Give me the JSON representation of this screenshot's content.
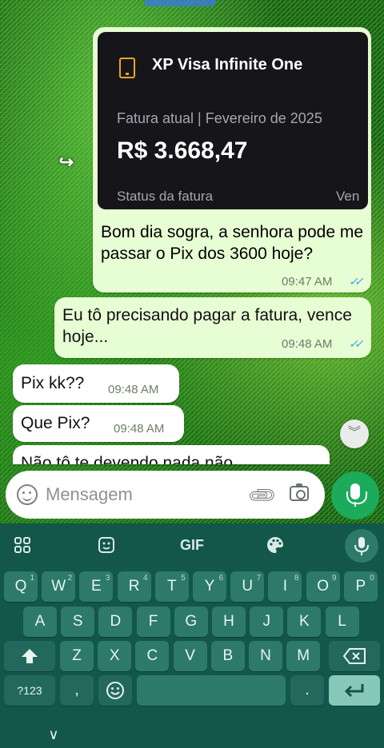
{
  "card": {
    "title": "XP Visa Infinite One",
    "subtitle": "Fatura atual  |  Fevereiro de 2025",
    "amount": "R$ 3.668,47",
    "status": "Status da fatura",
    "ven": "Ven"
  },
  "messages": [
    {
      "dir": "out",
      "text": "Bom dia sogra, a senhora pode me passar o Pix dos 3600 hoje?",
      "time": "09:47 AM",
      "read": true
    },
    {
      "dir": "out",
      "text": "Eu tô precisando pagar a fatura, vence hoje...",
      "time": "09:48 AM",
      "read": true
    },
    {
      "dir": "in",
      "text": "Pix kk??",
      "time": "09:48 AM"
    },
    {
      "dir": "in",
      "text": "Que Pix?",
      "time": "09:48 AM"
    },
    {
      "dir": "in",
      "text": "Não tô te devendo nada não",
      "time": ""
    }
  ],
  "composer": {
    "placeholder": "Mensagem"
  },
  "keyboard": {
    "toolbar_gif": "GIF",
    "row1": [
      {
        "k": "Q",
        "s": "1"
      },
      {
        "k": "W",
        "s": "2"
      },
      {
        "k": "E",
        "s": "3"
      },
      {
        "k": "R",
        "s": "4"
      },
      {
        "k": "T",
        "s": "5"
      },
      {
        "k": "Y",
        "s": "6"
      },
      {
        "k": "U",
        "s": "7"
      },
      {
        "k": "I",
        "s": "8"
      },
      {
        "k": "O",
        "s": "9"
      },
      {
        "k": "P",
        "s": "0"
      }
    ],
    "row2": [
      "A",
      "S",
      "D",
      "F",
      "G",
      "H",
      "J",
      "K",
      "L"
    ],
    "row3": [
      "Z",
      "X",
      "C",
      "V",
      "B",
      "N",
      "M"
    ],
    "sym": "?123",
    "comma": ",",
    "period": "."
  },
  "icons": {
    "forward": "forward-icon",
    "scroll": "chevron-down-double-icon",
    "emoji": "emoji-icon",
    "attach": "paperclip-icon",
    "camera": "camera-icon",
    "mic": "mic-icon"
  },
  "colors": {
    "outgoing_bubble": "#e7fdd4",
    "incoming_bubble": "#ffffff",
    "send_button": "#1bab5b",
    "keyboard_bg": "#13564a",
    "key_bg": "#2d7a6b",
    "read_ticks": "#3aa2e8"
  }
}
